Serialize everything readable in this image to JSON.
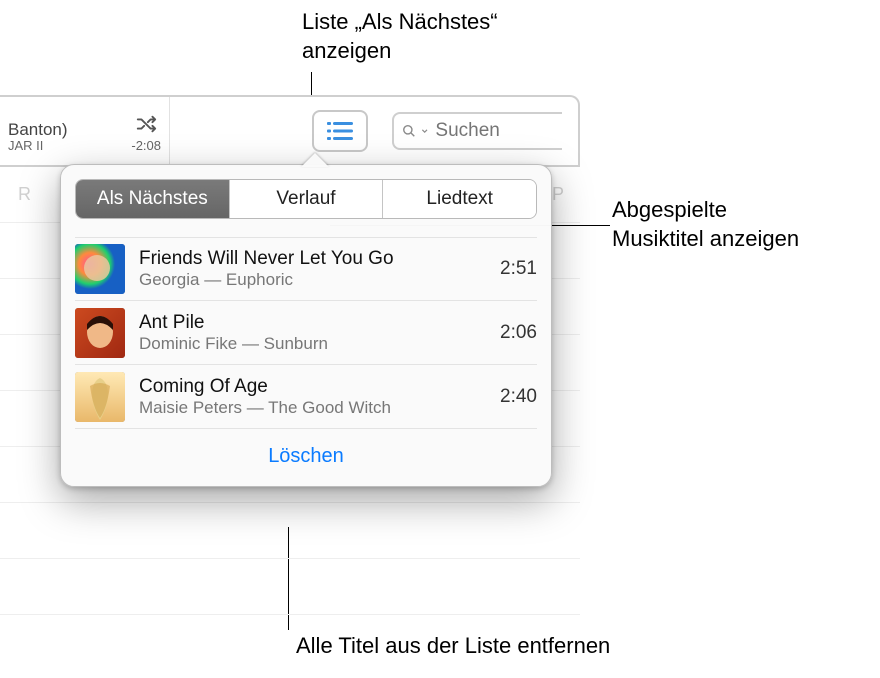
{
  "callouts": {
    "top": "Liste „Als Nächstes“\nanzeigen",
    "right": "Abgespielte\nMusiktitel anzeigen",
    "bottom": "Alle Titel aus der Liste entfernen"
  },
  "nowplaying": {
    "title_suffix": "Banton)",
    "subtitle_suffix": "JAR II",
    "remaining": "-2:08"
  },
  "search": {
    "placeholder": "Suchen"
  },
  "bg_column_headers": {
    "r_suffix": "R",
    "p_suffix": "P"
  },
  "popover": {
    "tabs": [
      "Als Nächstes",
      "Verlauf",
      "Liedtext"
    ],
    "active_tab": 0,
    "clear_label": "Löschen",
    "tracks": [
      {
        "title": "Friends Will Never Let You Go",
        "artist_album": "Georgia — Euphoric",
        "duration": "2:51"
      },
      {
        "title": "Ant Pile",
        "artist_album": "Dominic Fike — Sunburn",
        "duration": "2:06"
      },
      {
        "title": "Coming Of Age",
        "artist_album": "Maisie Peters — The Good Witch",
        "duration": "2:40"
      }
    ]
  }
}
